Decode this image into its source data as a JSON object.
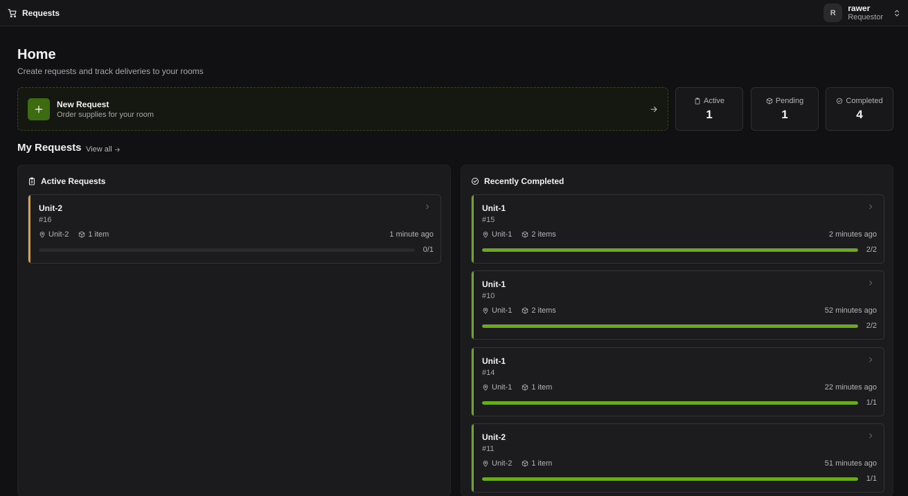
{
  "app": {
    "title": "Requests"
  },
  "user": {
    "initial": "R",
    "name": "rawer",
    "role": "Requestor"
  },
  "page": {
    "title": "Home",
    "subtitle": "Create requests and track deliveries to your rooms"
  },
  "new_request": {
    "title": "New Request",
    "subtitle": "Order supplies for your room"
  },
  "stats": [
    {
      "label": "Active",
      "value": "1",
      "icon": "clipboard-icon"
    },
    {
      "label": "Pending",
      "value": "1",
      "icon": "package-icon"
    },
    {
      "label": "Completed",
      "value": "4",
      "icon": "check-circle-icon"
    }
  ],
  "my_requests": {
    "title": "My Requests",
    "view_all": "View all"
  },
  "active_panel": {
    "title": "Active Requests",
    "cards": [
      {
        "unit": "Unit-2",
        "number": "#16",
        "location": "Unit-2",
        "items": "1 item",
        "time": "1 minute ago",
        "progress_label": "0/1",
        "progress": 0,
        "accent": "#e8a21a"
      }
    ]
  },
  "completed_panel": {
    "title": "Recently Completed",
    "cards": [
      {
        "unit": "Unit-1",
        "number": "#15",
        "location": "Unit-1",
        "items": "2 items",
        "time": "2 minutes ago",
        "progress_label": "2/2",
        "progress": 1,
        "accent": "#6aaa1c"
      },
      {
        "unit": "Unit-1",
        "number": "#10",
        "location": "Unit-1",
        "items": "2 items",
        "time": "52 minutes ago",
        "progress_label": "2/2",
        "progress": 1,
        "accent": "#6aaa1c"
      },
      {
        "unit": "Unit-1",
        "number": "#14",
        "location": "Unit-1",
        "items": "1 item",
        "time": "22 minutes ago",
        "progress_label": "1/1",
        "progress": 1,
        "accent": "#6aaa1c"
      },
      {
        "unit": "Unit-2",
        "number": "#11",
        "location": "Unit-2",
        "items": "1 item",
        "time": "51 minutes ago",
        "progress_label": "1/1",
        "progress": 1,
        "accent": "#6aaa1c"
      }
    ]
  },
  "colors": {
    "accent_green": "#6aaa1c",
    "accent_orange": "#e8a21a",
    "plus_bg": "#3d6b12"
  }
}
